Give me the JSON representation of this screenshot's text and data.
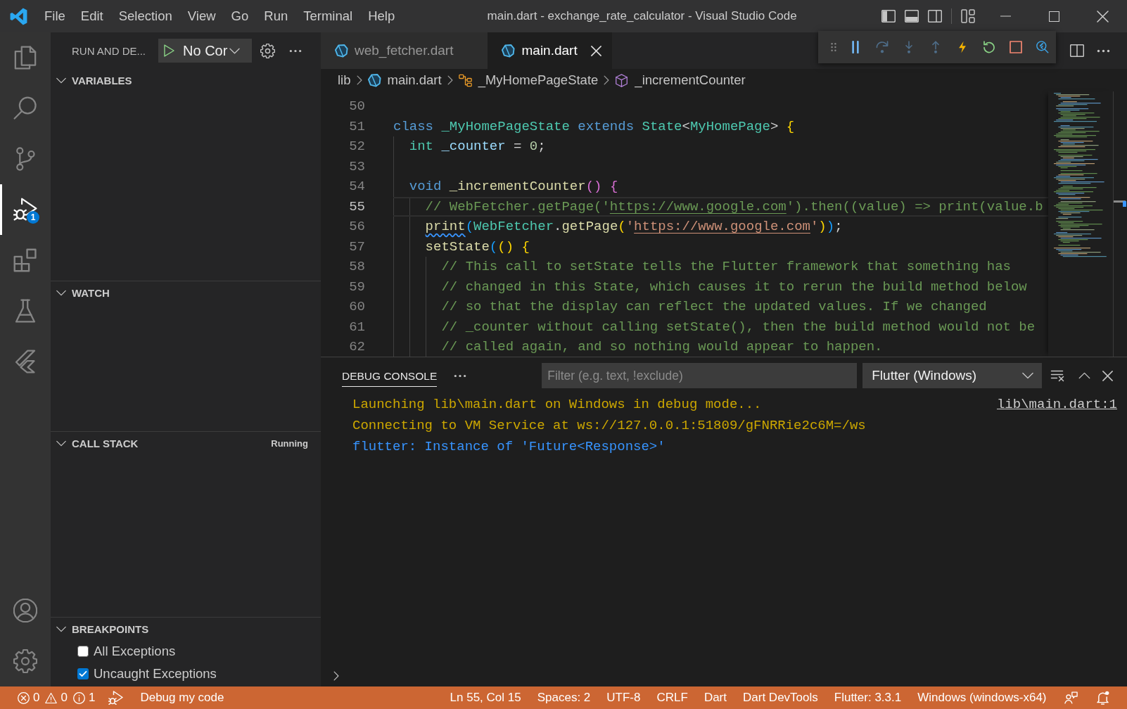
{
  "title_bar": {
    "menu": [
      "File",
      "Edit",
      "Selection",
      "View",
      "Go",
      "Run",
      "Terminal",
      "Help"
    ],
    "title": "main.dart - exchange_rate_calculator - Visual Studio Code",
    "layout_toggles": [
      {
        "kind": "primary-sidebar",
        "on": true
      },
      {
        "kind": "panel",
        "on": true
      },
      {
        "kind": "secondary-sidebar",
        "on": false
      }
    ]
  },
  "activity_bar": {
    "items": [
      {
        "kind": "explorer",
        "selected": false
      },
      {
        "kind": "search",
        "selected": false
      },
      {
        "kind": "source-control",
        "selected": false
      },
      {
        "kind": "run-debug",
        "selected": true,
        "badge": "1"
      },
      {
        "kind": "extensions",
        "selected": false
      },
      {
        "kind": "testing",
        "selected": false
      },
      {
        "kind": "flutter",
        "selected": false
      }
    ],
    "footer": [
      {
        "kind": "accounts"
      },
      {
        "kind": "manage"
      }
    ]
  },
  "sidebar": {
    "title": "RUN AND DE...",
    "launch_config": "No Cor",
    "sections": [
      {
        "title": "VARIABLES",
        "expanded": true
      },
      {
        "title": "WATCH",
        "expanded": true
      },
      {
        "title": "CALL STACK",
        "expanded": true,
        "status": "Running"
      },
      {
        "title": "BREAKPOINTS",
        "expanded": true,
        "items": [
          {
            "label": "All Exceptions",
            "checked": false
          },
          {
            "label": "Uncaught Exceptions",
            "checked": true
          }
        ]
      }
    ]
  },
  "tabs": [
    {
      "label": "web_fetcher.dart",
      "selected": false
    },
    {
      "label": "main.dart",
      "selected": true
    }
  ],
  "debug_toolbar": [
    {
      "kind": "pause",
      "disabled": false
    },
    {
      "kind": "step-over",
      "disabled": true
    },
    {
      "kind": "step-into",
      "disabled": true
    },
    {
      "kind": "step-out",
      "disabled": true
    },
    {
      "kind": "hot-reload",
      "disabled": false
    },
    {
      "kind": "restart",
      "disabled": false
    },
    {
      "kind": "stop",
      "disabled": false
    },
    {
      "kind": "inspector",
      "disabled": false
    }
  ],
  "breadcrumbs": [
    {
      "kind": "folder",
      "label": "lib"
    },
    {
      "kind": "file",
      "label": "main.dart"
    },
    {
      "kind": "class",
      "label": "_MyHomePageState"
    },
    {
      "kind": "method",
      "label": "_incrementCounter"
    }
  ],
  "editor": {
    "lines": [
      {
        "number": "50",
        "current": false
      },
      {
        "number": "51",
        "current": false,
        "tokens": [
          {
            "text": "class ",
            "kind": "keyword"
          },
          {
            "text": "_MyHomePageState ",
            "kind": "type"
          },
          {
            "text": "extends ",
            "kind": "keyword"
          },
          {
            "text": "State",
            "kind": "type"
          },
          {
            "text": "<",
            "kind": "plain"
          },
          {
            "text": "MyHomePage",
            "kind": "type"
          },
          {
            "text": "> ",
            "kind": "plain"
          },
          {
            "text": "{",
            "kind": "bracket-1"
          }
        ]
      },
      {
        "number": "52",
        "current": false,
        "tokens": [
          {
            "text": "  int ",
            "kind": "type"
          },
          {
            "text": "_counter",
            "kind": "variable"
          },
          {
            "text": " = ",
            "kind": "plain"
          },
          {
            "text": "0",
            "kind": "number"
          },
          {
            "text": ";",
            "kind": "plain"
          }
        ]
      },
      {
        "number": "53",
        "current": false
      },
      {
        "number": "54",
        "current": false,
        "tokens": [
          {
            "text": "  void ",
            "kind": "keyword"
          },
          {
            "text": "_incrementCounter",
            "kind": "function"
          },
          {
            "text": "() {",
            "kind": "bracket-2"
          }
        ]
      },
      {
        "number": "55",
        "current": true,
        "tokens": [
          {
            "text": "    // WebFetcher.getPage('",
            "kind": "comment"
          },
          {
            "text": "https://www.google.com",
            "kind": "comment-link"
          },
          {
            "text": "').then((value) => print(value.b",
            "kind": "comment"
          }
        ]
      },
      {
        "number": "56",
        "current": false,
        "tokens": [
          {
            "text": "    print",
            "kind": "function-warning"
          },
          {
            "text": "(",
            "kind": "bracket-3"
          },
          {
            "text": "WebFetcher",
            "kind": "type"
          },
          {
            "text": ".",
            "kind": "plain"
          },
          {
            "text": "getPage",
            "kind": "function"
          },
          {
            "text": "(",
            "kind": "bracket-1"
          },
          {
            "text": "'",
            "kind": "string"
          },
          {
            "text": "https://www.google.com",
            "kind": "string-link"
          },
          {
            "text": "'",
            "kind": "string"
          },
          {
            "text": ")",
            "kind": "bracket-1"
          },
          {
            "text": ")",
            "kind": "bracket-3"
          },
          {
            "text": ";",
            "kind": "plain"
          }
        ]
      },
      {
        "number": "57",
        "current": false,
        "tokens": [
          {
            "text": "    setState",
            "kind": "function"
          },
          {
            "text": "(",
            "kind": "bracket-3"
          },
          {
            "text": "() {",
            "kind": "bracket-1"
          }
        ]
      },
      {
        "number": "58",
        "current": false,
        "tokens": [
          {
            "text": "      // This call to setState tells the Flutter framework that something has",
            "kind": "comment"
          }
        ]
      },
      {
        "number": "59",
        "current": false,
        "tokens": [
          {
            "text": "      // changed in this State, which causes it to rerun the build method below",
            "kind": "comment"
          }
        ]
      },
      {
        "number": "60",
        "current": false,
        "tokens": [
          {
            "text": "      // so that the display can reflect the updated values. If we changed",
            "kind": "comment"
          }
        ]
      },
      {
        "number": "61",
        "current": false,
        "tokens": [
          {
            "text": "      // _counter without calling setState(), then the build method would not be",
            "kind": "comment"
          }
        ]
      },
      {
        "number": "62",
        "current": false,
        "tokens": [
          {
            "text": "      // called again, and so nothing would appear to happen.",
            "kind": "comment"
          }
        ]
      }
    ]
  },
  "panel": {
    "tabs": [
      {
        "label": "DEBUG CONSOLE",
        "selected": true
      }
    ],
    "filter": {
      "placeholder": "Filter (e.g. text, !exclude)"
    },
    "session": "Flutter (Windows)",
    "output": [
      {
        "kind": "status",
        "text": "Launching lib\\main.dart on Windows in debug mode...",
        "source": "lib\\main.dart:1"
      },
      {
        "kind": "status",
        "text": "Connecting to VM Service at ws://127.0.0.1:51809/gFNRRie2c6M=/ws"
      },
      {
        "kind": "stdout",
        "text": "flutter: Instance of 'Future<Response>'"
      }
    ]
  },
  "status_bar": {
    "problems": [
      {
        "kind": "error",
        "count": "0"
      },
      {
        "kind": "warning",
        "count": "0"
      },
      {
        "kind": "info",
        "count": "1"
      }
    ],
    "launch": "Debug my code",
    "items": [
      "Ln 55, Col 15",
      "Spaces: 2",
      "UTF-8",
      "CRLF",
      "Dart",
      "Dart DevTools",
      "Flutter: 3.3.1",
      "Windows (windows-x64)"
    ]
  }
}
